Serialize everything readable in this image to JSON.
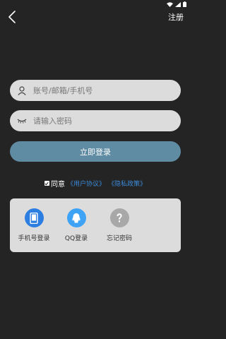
{
  "header": {
    "register_label": "注册"
  },
  "form": {
    "account_placeholder": "账号/邮箱/手机号",
    "password_placeholder": "请输入密码",
    "login_label": "立即登录"
  },
  "agreement": {
    "prefix": "同意",
    "user_agreement": "《用户协议》",
    "privacy_policy": "《隐私政策》"
  },
  "other_login": [
    {
      "label": "手机号登录",
      "icon": "phone-icon",
      "color": "#2c7ee0"
    },
    {
      "label": "QQ登录",
      "icon": "qq-icon",
      "color": "#3fa3f5"
    },
    {
      "label": "忘记密码",
      "icon": "question-icon",
      "color": "#a8a8a8"
    }
  ],
  "colors": {
    "background": "#242424",
    "field": "#dcdcdc",
    "login_button": "#5f8ba3",
    "link": "#3b8ad9"
  }
}
